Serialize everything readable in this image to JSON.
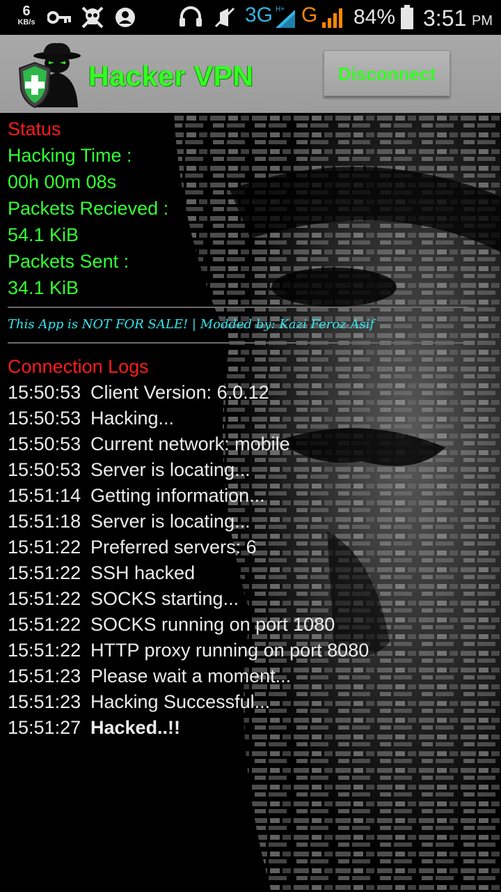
{
  "status_bar": {
    "net_speed_value": "6",
    "net_speed_unit": "KB/s",
    "network_3g": "3G",
    "network_g": "G",
    "battery_percent": "84%",
    "time": "3:51",
    "ampm": "PM",
    "icons": [
      "key-icon",
      "skull-icon",
      "account-icon",
      "headset-icon",
      "mute-icon",
      "signal-3g-icon",
      "signal-g-icon",
      "battery-icon"
    ]
  },
  "header": {
    "title": "Hacker VPN",
    "disconnect_label": "Disconnect",
    "accent_color": "#33ff22"
  },
  "status": {
    "heading": "Status",
    "hacking_time_label": "Hacking Time :",
    "hacking_time_value": "00h 00m 08s",
    "packets_received_label": "Packets Recieved :",
    "packets_received_value": "54.1 KiB",
    "packets_sent_label": "Packets Sent :",
    "packets_sent_value": "34.1 KiB"
  },
  "promo_text": "This App is NOT FOR SALE! | Modded by: Kazi Feroz Asif",
  "logs": {
    "heading": "Connection Logs",
    "entries": [
      {
        "time": "15:50:53",
        "message": "Client Version: 6.0.12"
      },
      {
        "time": "15:50:53",
        "message": "Hacking..."
      },
      {
        "time": "15:50:53",
        "message": "Current network: mobile"
      },
      {
        "time": "15:50:53",
        "message": "Server is locating..."
      },
      {
        "time": "15:51:14",
        "message": "Getting information..."
      },
      {
        "time": "15:51:18",
        "message": "Server is locating..."
      },
      {
        "time": "15:51:22",
        "message": "Preferred servers: 6"
      },
      {
        "time": "15:51:22",
        "message": "SSH hacked"
      },
      {
        "time": "15:51:22",
        "message": "SOCKS starting..."
      },
      {
        "time": "15:51:22",
        "message": "SOCKS running on port 1080"
      },
      {
        "time": "15:51:22",
        "message": "HTTP proxy running on port 8080"
      },
      {
        "time": "15:51:23",
        "message": "Please wait a moment..."
      },
      {
        "time": "15:51:23",
        "message": "Hacking Successful..."
      },
      {
        "time": "15:51:27",
        "message": "Hacked..!!"
      }
    ]
  },
  "colors": {
    "status_heading": "#ff1a1a",
    "status_text": "#33ff33",
    "promo": "#33e6f0",
    "log_text": "#ececec"
  }
}
